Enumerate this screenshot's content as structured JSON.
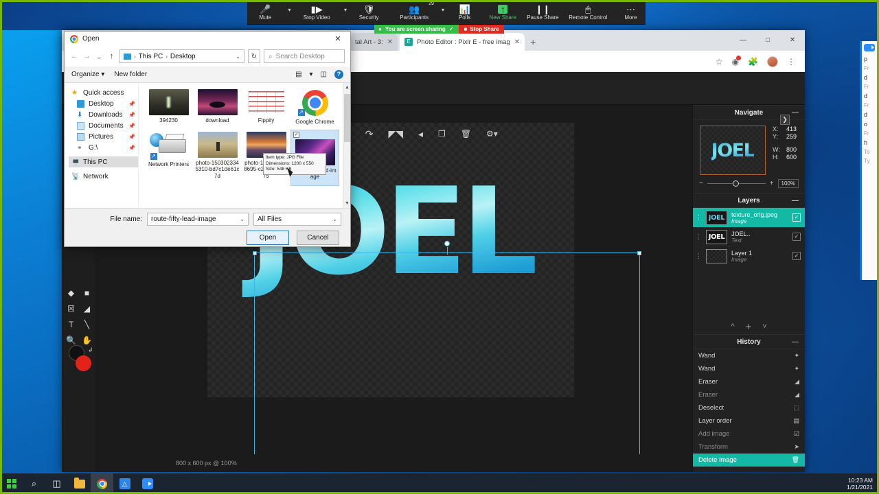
{
  "zoom_toolbar": {
    "items": [
      {
        "label": "Mute",
        "icon": "microphone-icon",
        "caret": true,
        "green": false
      },
      {
        "label": "Stop Video",
        "icon": "video-camera-icon",
        "caret": true,
        "green": false
      },
      {
        "label": "Security",
        "icon": "shield-icon",
        "caret": false,
        "green": false
      },
      {
        "label": "Participants",
        "icon": "people-icon",
        "caret": true,
        "green": false,
        "count": "29"
      },
      {
        "label": "Polls",
        "icon": "bar-chart-icon",
        "caret": false,
        "green": false
      },
      {
        "label": "New Share",
        "icon": "share-up-arrow-icon",
        "caret": false,
        "green": true
      },
      {
        "label": "Pause Share",
        "icon": "pause-icon",
        "caret": false,
        "green": false
      },
      {
        "label": "Remote Control",
        "icon": "mouse-icon",
        "caret": false,
        "green": false
      },
      {
        "label": "More",
        "icon": "ellipsis-icon",
        "caret": false,
        "green": false
      }
    ],
    "sharing_status": "You are screen sharing",
    "stop_share": "Stop Share"
  },
  "browser": {
    "tabs": [
      {
        "title": "tal Art - 3:",
        "active": false
      },
      {
        "title": "Photo Editor : Pixlr E - free imag",
        "active": true
      }
    ],
    "new_tab_label": "+",
    "window_buttons": [
      "—",
      "□",
      "✕"
    ],
    "toolbar_icons": [
      "star-icon",
      "extension-alert-icon",
      "puzzle-extension-icon",
      "profile-avatar",
      "kebab-menu-icon"
    ]
  },
  "pixlr": {
    "edit_tools": [
      "undo-icon",
      "redo-icon",
      "flip-horizontal-icon",
      "flip-vertical-icon",
      "duplicate-icon",
      "trash-icon",
      "settings-gear-icon"
    ],
    "left_tools": [
      "shape-fill-icon",
      "rectangle-select-icon",
      "marquee-icon",
      "paint-bucket-icon",
      "text-tool-icon",
      "eyedropper-icon",
      "zoom-tool-icon",
      "hand-tool-icon"
    ],
    "colors": {
      "primary": "#111111",
      "secondary": "#e32219"
    },
    "status_bar": "800 x 600 px @ 100%",
    "canvas_text": "JOEL",
    "collapse_button": "❯"
  },
  "navigate": {
    "title": "Navigate",
    "minimize": "—",
    "thumb_text": "JOEL",
    "coords": [
      {
        "key": "X:",
        "value": "413"
      },
      {
        "key": "Y:",
        "value": "259"
      },
      {
        "key": "W:",
        "value": "800"
      },
      {
        "key": "H:",
        "value": "600"
      }
    ],
    "zoom_minus": "−",
    "zoom_plus": "+",
    "zoom_value": "100%"
  },
  "layers": {
    "title": "Layers",
    "minimize": "—",
    "items": [
      {
        "name": "texture_orig.jpeg",
        "kind": "Image",
        "selected": true,
        "thumb": "texture",
        "visible": "✓"
      },
      {
        "name": "JOEL..",
        "kind": "Text",
        "selected": false,
        "thumb": "text",
        "visible": "✓"
      },
      {
        "name": "Layer 1",
        "kind": "Image",
        "selected": false,
        "thumb": "checker",
        "visible": "✓"
      }
    ],
    "actions": [
      "move-up-icon",
      "add-layer-icon",
      "move-down-icon"
    ]
  },
  "history": {
    "title": "History",
    "minimize": "—",
    "items": [
      {
        "label": "Wand",
        "icon": "✦",
        "selected": false,
        "dim": false
      },
      {
        "label": "Wand",
        "icon": "✦",
        "selected": false,
        "dim": false
      },
      {
        "label": "Eraser",
        "icon": "◢",
        "selected": false,
        "dim": false
      },
      {
        "label": "Eraser",
        "icon": "◢",
        "selected": false,
        "dim": true
      },
      {
        "label": "Deselect",
        "icon": "⬚",
        "selected": false,
        "dim": false
      },
      {
        "label": "Layer order",
        "icon": "▤",
        "selected": false,
        "dim": false
      },
      {
        "label": "Add image",
        "icon": "❑",
        "selected": false,
        "dim": true
      },
      {
        "label": "Transform",
        "icon": "➤",
        "selected": false,
        "dim": true
      },
      {
        "label": "Delete image",
        "icon": "Ὕ1",
        "selected": true,
        "dim": false
      }
    ]
  },
  "open_dialog": {
    "title": "Open",
    "close": "✕",
    "nav": {
      "back": "←",
      "forward": "→",
      "recent": "⌄",
      "up": "↑",
      "breadcrumb": [
        "This PC",
        "Desktop"
      ],
      "breadcrumb_sep": "›",
      "dropdown": "⌄",
      "refresh": "↻",
      "search_placeholder": "Search Desktop",
      "search_icon": "search-icon"
    },
    "command_bar": {
      "organize": "Organize",
      "organize_caret": "▾",
      "new_folder": "New folder",
      "view_icon": "view-layout-icon",
      "view_caret": "▾",
      "pane_icon": "preview-pane-icon",
      "help": "?"
    },
    "sidebar": [
      {
        "label": "Quick access",
        "icon": "star-icon",
        "pinned": false,
        "state": "none"
      },
      {
        "label": "Desktop",
        "icon": "desktop-icon",
        "pinned": true,
        "state": "none"
      },
      {
        "label": "Downloads",
        "icon": "downloads-icon",
        "pinned": true,
        "state": "none"
      },
      {
        "label": "Documents",
        "icon": "documents-icon",
        "pinned": true,
        "state": "none"
      },
      {
        "label": "Pictures",
        "icon": "pictures-icon",
        "pinned": true,
        "state": "none"
      },
      {
        "label": "G:\\",
        "icon": "drive-icon",
        "pinned": true,
        "state": "none"
      },
      {
        "label": "This PC",
        "icon": "this-pc-icon",
        "pinned": false,
        "state": "active"
      },
      {
        "label": "Network",
        "icon": "network-icon",
        "pinned": false,
        "state": "none"
      }
    ],
    "files": [
      {
        "label": "394230",
        "thumb": "forest",
        "selected": false,
        "shortcut": false
      },
      {
        "label": "download",
        "thumb": "download",
        "selected": false,
        "shortcut": false
      },
      {
        "label": "Fippity",
        "thumb": "fippity",
        "selected": false,
        "shortcut": false
      },
      {
        "label": "Google Chrome",
        "thumb": "chrome",
        "selected": false,
        "shortcut": true
      },
      {
        "label": "Network Printers",
        "thumb": "printer",
        "selected": false,
        "shortcut": true
      },
      {
        "label": "photo-1503023345310-bd7c1de61c7d",
        "thumb": "field",
        "selected": false,
        "shortcut": false
      },
      {
        "label": "photo-1503803548695-c2a7b4a5b875",
        "thumb": "sunset",
        "selected": false,
        "shortcut": false
      },
      {
        "label": "route-fifty-lead-image",
        "thumb": "galaxy",
        "selected": true,
        "shortcut": false
      }
    ],
    "tooltip": {
      "item_type": "Item type: JPG File",
      "dimensions": "Dimensions: 1200 x 550",
      "size": "Size: 548 KB"
    },
    "footer": {
      "file_name_label": "File name:",
      "file_name_value": "route-fifty-lead-image",
      "file_type_value": "All Files",
      "dropdown_caret": "⌄",
      "open_button": "Open",
      "cancel_button": "Cancel"
    },
    "scroll": {
      "up": "▲",
      "down": "▼"
    }
  },
  "zoom_chat": {
    "lines": [
      "p",
      "Fr",
      "d",
      "Fr",
      "d",
      "Fr",
      "d",
      "o",
      "Fr",
      "h",
      "To",
      "Ty"
    ]
  },
  "taskbar": {
    "items": [
      {
        "name": "start-button",
        "icon": "windows-logo"
      },
      {
        "name": "search-button",
        "icon": "search-icon"
      },
      {
        "name": "task-view-button",
        "icon": "task-view-icon"
      },
      {
        "name": "file-explorer-button",
        "icon": "folder-icon"
      },
      {
        "name": "chrome-button",
        "icon": "chrome-icon"
      },
      {
        "name": "drive-button",
        "icon": "drive-icon"
      },
      {
        "name": "zoom-button",
        "icon": "zoom-icon"
      }
    ],
    "clock_time": "10:23 AM",
    "clock_date": "1/21/2021"
  }
}
